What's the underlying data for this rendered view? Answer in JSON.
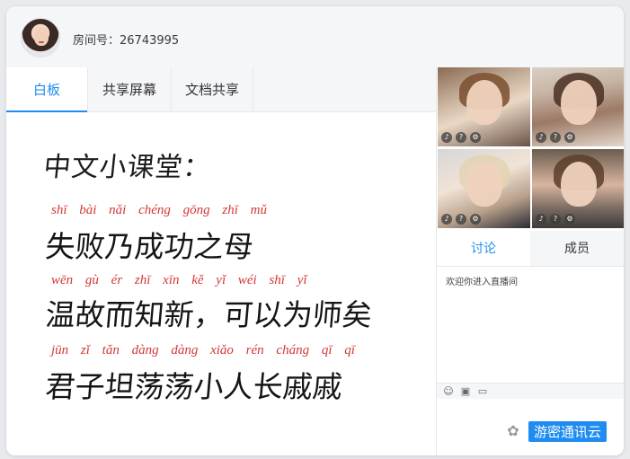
{
  "header": {
    "room_label": "房间号：26743995"
  },
  "left_tabs": [
    {
      "label": "白板",
      "active": true
    },
    {
      "label": "共享屏幕",
      "active": false
    },
    {
      "label": "文档共享",
      "active": false
    }
  ],
  "whiteboard": {
    "title": "中文小课堂：",
    "lines": [
      {
        "pinyin": "shī  bài  nǎi chéng gōng zhī mǔ",
        "text": "失败乃成功之母"
      },
      {
        "pinyin": "wēn  gù   ér  zhī  xīn  kě yǐ wéi shī yǐ",
        "text": "温故而知新，可以为师矣"
      },
      {
        "pinyin": "jūn  zǐ  tǎn dàng dàng xiǎo rén cháng qī  qī",
        "text": "君子坦荡荡小人长戚戚"
      }
    ]
  },
  "videos": [
    {
      "name": "video-1",
      "icons": [
        "mic-icon",
        "info-icon",
        "settings-icon"
      ]
    },
    {
      "name": "video-2",
      "icons": [
        "mic-icon",
        "info-icon",
        "settings-icon"
      ]
    },
    {
      "name": "video-3",
      "icons": [
        "mic-icon",
        "info-icon",
        "settings-icon"
      ]
    },
    {
      "name": "video-4",
      "icons": [
        "mic-icon",
        "info-icon",
        "settings-icon"
      ]
    }
  ],
  "right_tabs": [
    {
      "label": "讨论",
      "active": true
    },
    {
      "label": "成员",
      "active": false
    }
  ],
  "chat": {
    "messages": [
      "欢迎你进入直播间"
    ]
  },
  "toolbar": {
    "icons": [
      "emoji-icon",
      "image-icon",
      "folder-icon"
    ]
  },
  "watermark": {
    "text": "游密通讯云"
  },
  "colors": {
    "accent": "#1e8cf0",
    "pinyin": "#d23636",
    "background": "#e9eaee"
  }
}
